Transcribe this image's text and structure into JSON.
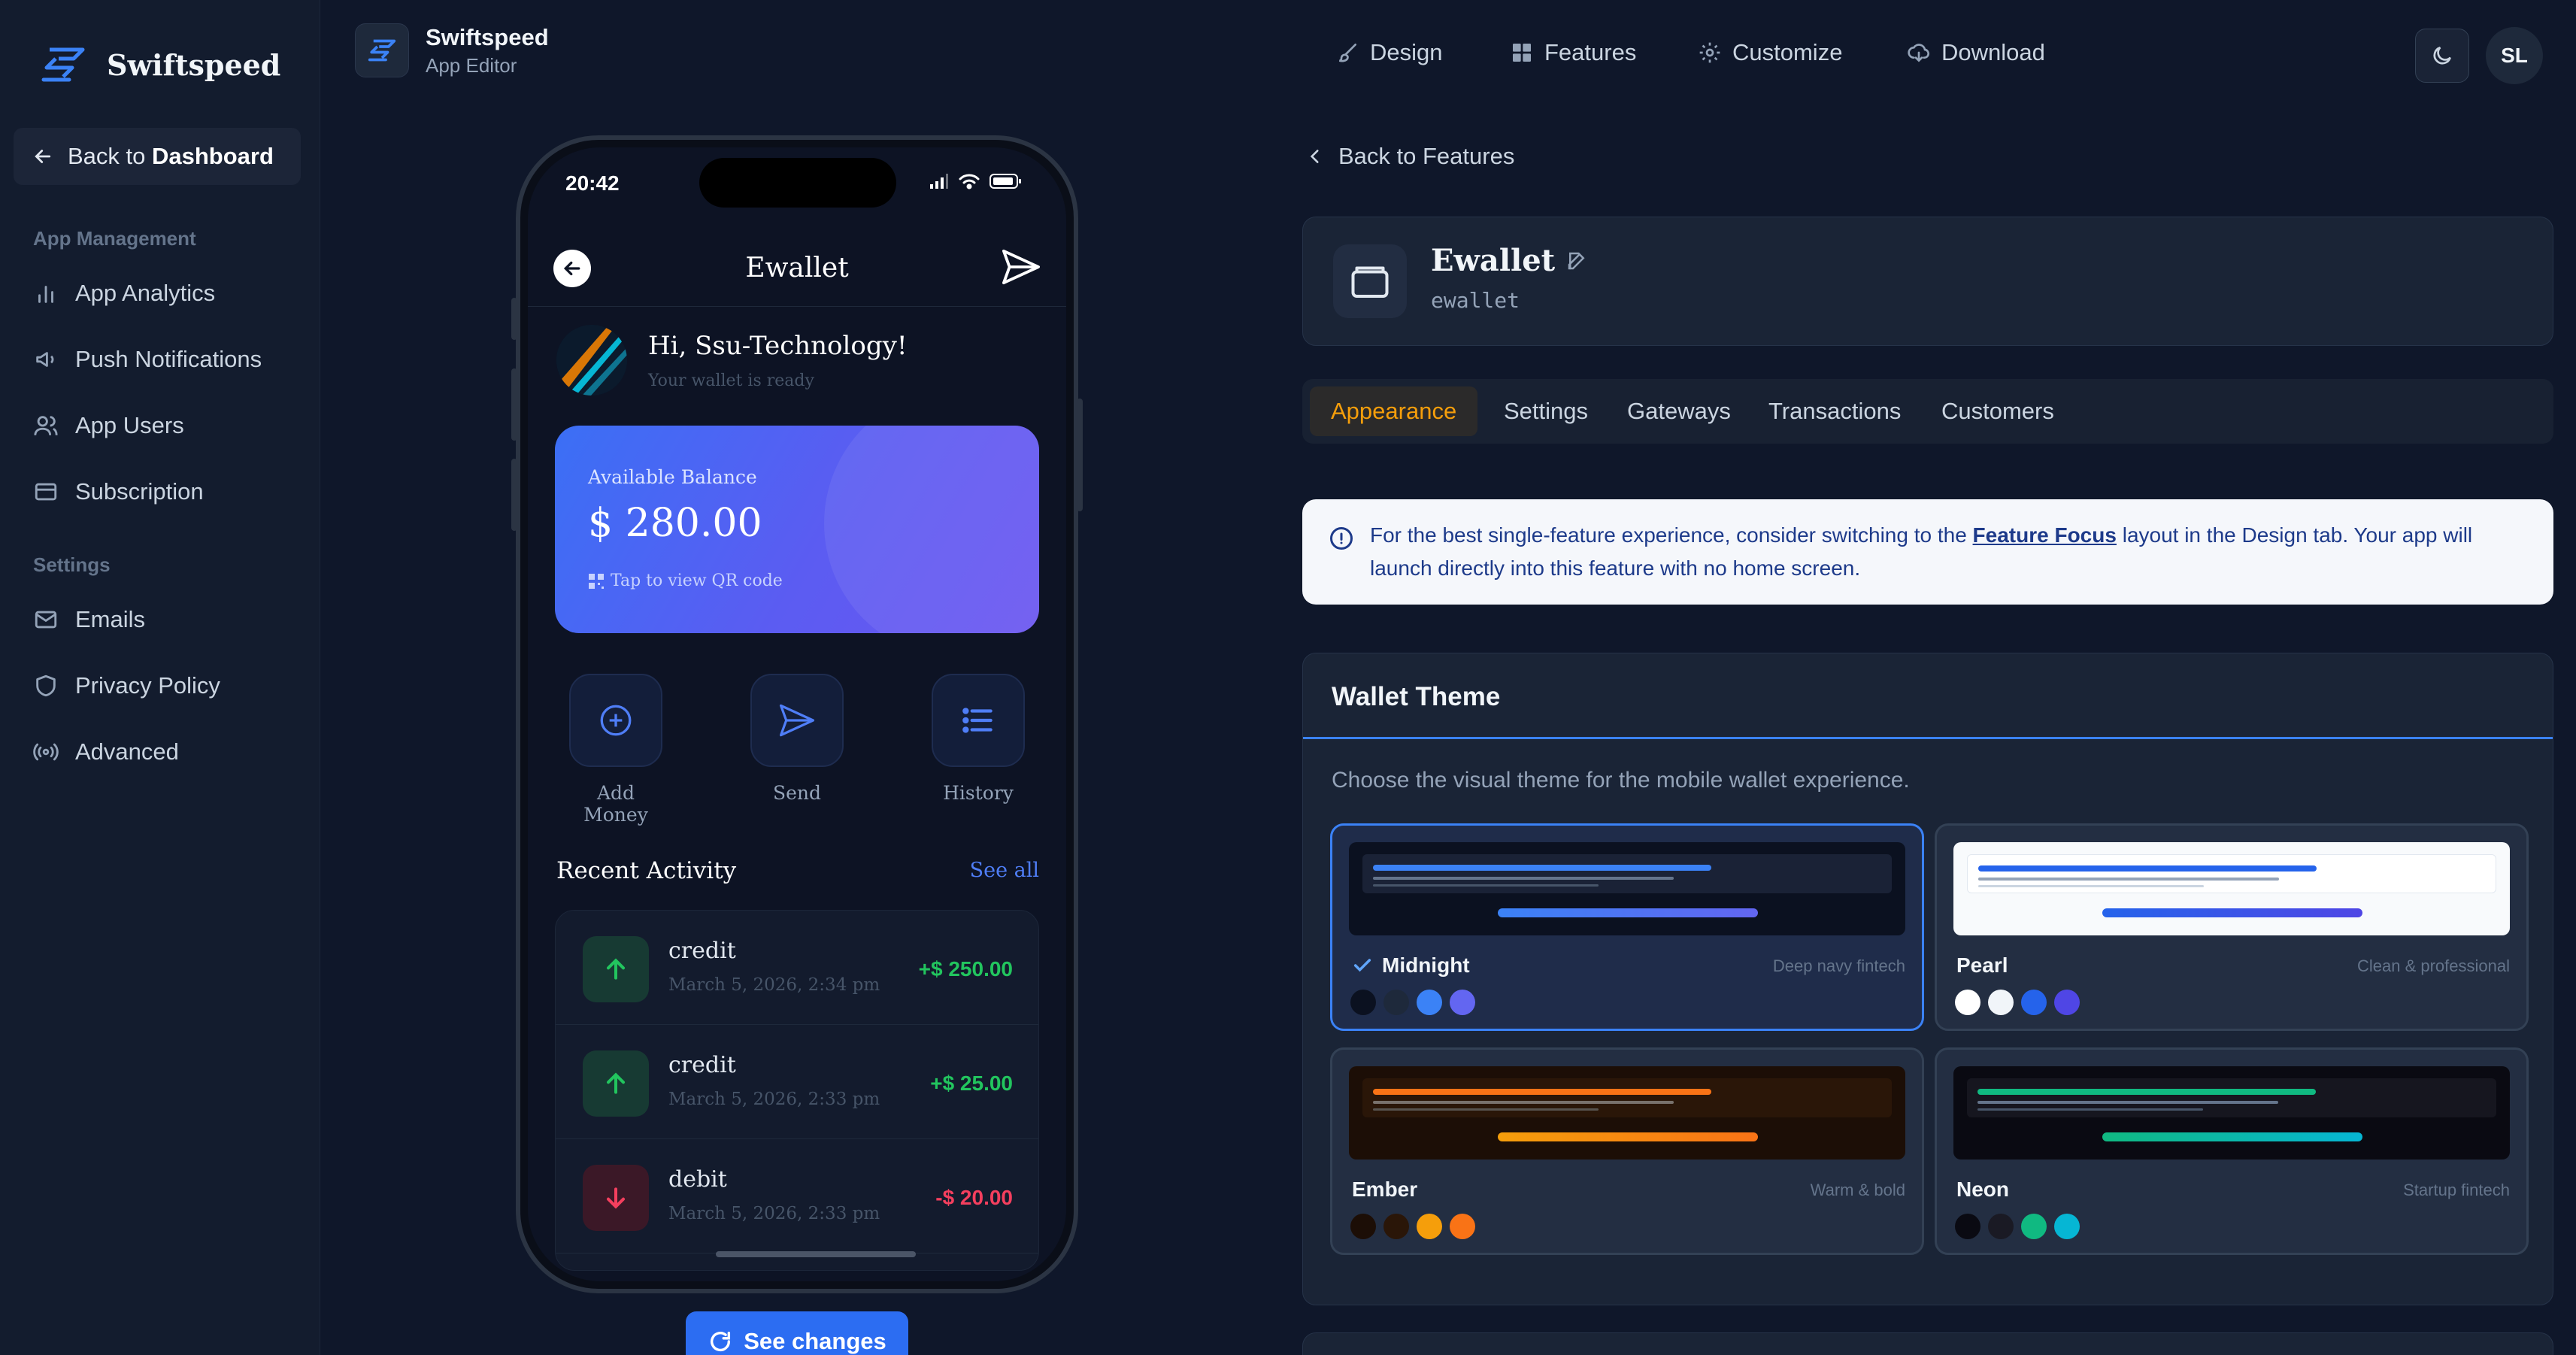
{
  "sidebar": {
    "brand": "Swiftspeed",
    "back_prefix": "Back to ",
    "back_target": "Dashboard",
    "section_app": "App Management",
    "section_settings": "Settings",
    "items": [
      {
        "label": "App Analytics",
        "icon": "bar-chart-icon"
      },
      {
        "label": "Push Notifications",
        "icon": "megaphone-icon"
      },
      {
        "label": "App Users",
        "icon": "users-icon"
      },
      {
        "label": "Subscription",
        "icon": "credit-card-icon"
      },
      {
        "label": "Emails",
        "icon": "mail-icon"
      },
      {
        "label": "Privacy Policy",
        "icon": "shield-icon"
      },
      {
        "label": "Advanced",
        "icon": "broadcast-icon"
      }
    ]
  },
  "topbar": {
    "app_name": "Swiftspeed",
    "app_sub": "App Editor",
    "nav": [
      {
        "label": "Design",
        "icon": "brush-icon"
      },
      {
        "label": "Features",
        "icon": "grid-icon"
      },
      {
        "label": "Customize",
        "icon": "gear-icon"
      },
      {
        "label": "Download",
        "icon": "cloud-download-icon"
      }
    ],
    "avatar_initials": "SL"
  },
  "phone": {
    "time": "20:42",
    "title": "Ewallet",
    "greeting": "Hi, Ssu-Technology!",
    "greeting_sub": "Your wallet is ready",
    "balance_label": "Available Balance",
    "balance_amount": "$ 280.00",
    "qr_hint": "Tap to view QR code",
    "actions": [
      {
        "label": "Add Money",
        "icon": "plus-circle-icon"
      },
      {
        "label": "Send",
        "icon": "send-icon"
      },
      {
        "label": "History",
        "icon": "list-icon"
      }
    ],
    "recent_title": "Recent Activity",
    "see_all": "See all",
    "transactions": [
      {
        "type": "credit",
        "date": "March 5, 2026, 2:34 pm",
        "amount": "+$ 250.00",
        "kind": "credit"
      },
      {
        "type": "credit",
        "date": "March 5, 2026, 2:33 pm",
        "amount": "+$ 25.00",
        "kind": "credit"
      },
      {
        "type": "debit",
        "date": "March 5, 2026, 2:33 pm",
        "amount": "-$ 20.00",
        "kind": "debit"
      }
    ]
  },
  "see_changes": "See changes",
  "right": {
    "back_features": "Back to Features",
    "feature_name": "Ewallet",
    "feature_slug": "ewallet",
    "tabs": [
      "Appearance",
      "Settings",
      "Gateways",
      "Transactions",
      "Customers"
    ],
    "active_tab": "Appearance",
    "info_before": "For the best single-feature experience, consider switching to the ",
    "info_link": "Feature Focus",
    "info_after": " layout in the Design tab. Your app will launch directly into this feature with no home screen.",
    "panel_title": "Wallet Theme",
    "panel_desc": "Choose the visual theme for the mobile wallet experience.",
    "themes": [
      {
        "name": "Midnight",
        "tag": "Deep navy fintech",
        "selected": true,
        "swatches": [
          "#0b1120",
          "#1e293b",
          "#3b82f6",
          "#6366f1"
        ]
      },
      {
        "name": "Pearl",
        "tag": "Clean & professional",
        "selected": false,
        "swatches": [
          "#ffffff",
          "#f8fafc",
          "#2563eb",
          "#4f46e5"
        ]
      },
      {
        "name": "Ember",
        "tag": "Warm & bold",
        "selected": false,
        "swatches": [
          "#1c0e06",
          "#2a1608",
          "#f59e0b",
          "#f97316"
        ]
      },
      {
        "name": "Neon",
        "tag": "Startup fintech",
        "selected": false,
        "swatches": [
          "#0a0a12",
          "#1a1a24",
          "#10b981",
          "#06b6d4"
        ]
      }
    ]
  },
  "colors": {
    "accent": "#3b82f6",
    "active_tab": "#f59e0b",
    "credit": "#22c55e",
    "debit": "#f43f5e"
  }
}
